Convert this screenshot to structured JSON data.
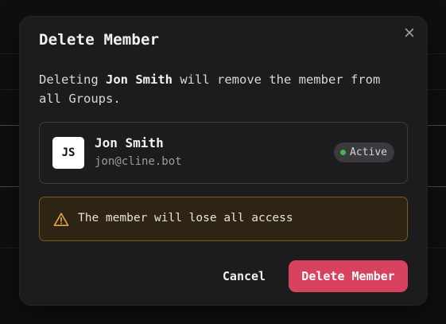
{
  "colors": {
    "modal_bg": "#1c1c1e",
    "danger_button": "#d8425f",
    "warning_border": "#7a5a1e",
    "warning_bg": "#2e2413",
    "warning_icon": "#e0a447",
    "status_active": "#4caf50"
  },
  "dialog": {
    "title": "Delete Member",
    "close_icon": "close-icon",
    "description": {
      "prefix": "Deleting ",
      "member_name": "Jon Smith",
      "suffix": " will remove the member from all Groups."
    }
  },
  "member": {
    "initials": "JS",
    "name": "Jon Smith",
    "email": "jon@cline.bot",
    "status": "Active"
  },
  "warning": {
    "icon": "warning-triangle-icon",
    "text": "The member will lose all access"
  },
  "actions": {
    "cancel_label": "Cancel",
    "delete_label": "Delete Member"
  }
}
